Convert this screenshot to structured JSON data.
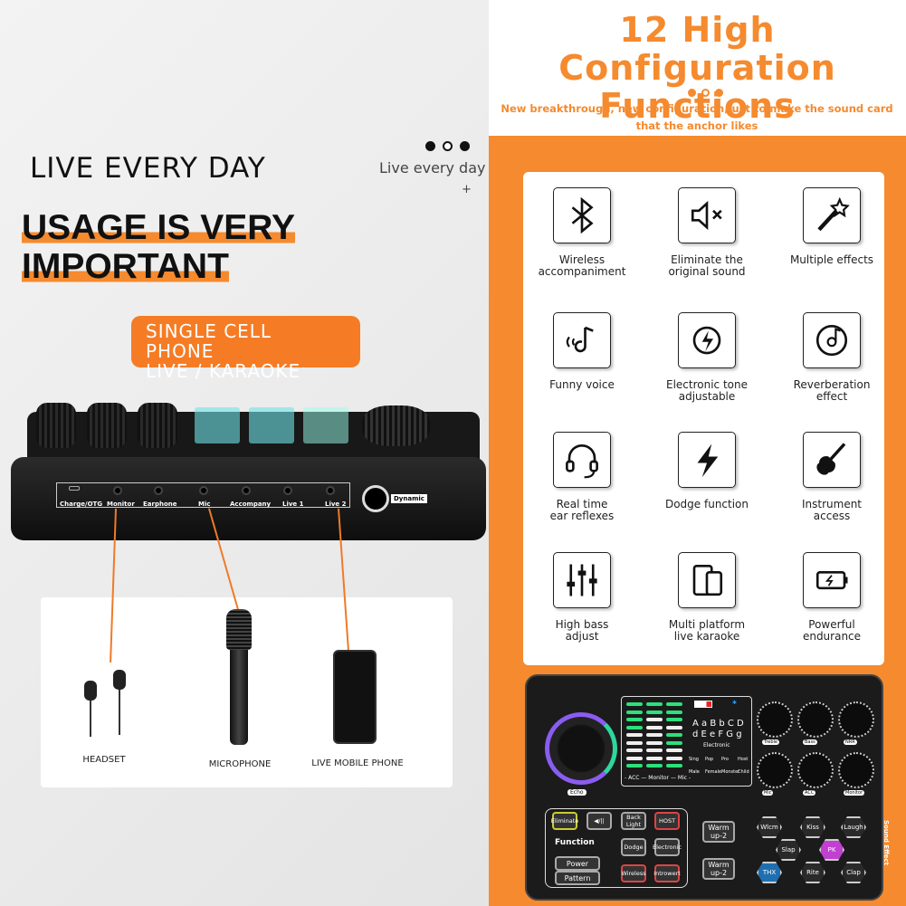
{
  "left": {
    "title": "LIVE EVERY DAY",
    "subtitle": "Live every day",
    "plus": "+",
    "headline": [
      "USAGE IS VERY",
      "IMPORTANT"
    ],
    "pill": [
      "SINGLE CELL PHONE",
      "LIVE / KARAOKE"
    ],
    "ports": [
      "Charge/OTG",
      "Monitor",
      "Earphone",
      "Mic",
      "Accompany",
      "Live 1",
      "Live 2"
    ],
    "dynamic": "Dynamic",
    "items": [
      "HEADSET",
      "MICROPHONE",
      "LIVE MOBILE PHONE"
    ],
    "accent": "#f58a2e"
  },
  "right": {
    "title": [
      "12 High Configuration",
      "Functions"
    ],
    "subtitle": [
      "New breakthrough, new configuration,just to make the sound card",
      "that the anchor likes"
    ],
    "features": [
      {
        "icon": "bluetooth-icon",
        "label": [
          "Wireless",
          "accompaniment"
        ]
      },
      {
        "icon": "mute-speaker-icon",
        "label": [
          "Eliminate the",
          "original sound"
        ]
      },
      {
        "icon": "magic-wand-icon",
        "label": [
          "Multiple effects",
          ""
        ]
      },
      {
        "icon": "music-note-voice-icon",
        "label": [
          "Funny voice",
          ""
        ]
      },
      {
        "icon": "electric-tone-icon",
        "label": [
          "Electronic tone",
          "adjustable"
        ]
      },
      {
        "icon": "music-disc-icon",
        "label": [
          "Reverberation",
          "effect"
        ]
      },
      {
        "icon": "headset-icon",
        "label": [
          "Real time",
          "ear reflexes"
        ]
      },
      {
        "icon": "lightning-icon",
        "label": [
          "Dodge function",
          ""
        ]
      },
      {
        "icon": "guitar-icon",
        "label": [
          "Instrument",
          "access"
        ]
      },
      {
        "icon": "equalizer-sliders-icon",
        "label": [
          "High bass",
          "adjust"
        ]
      },
      {
        "icon": "devices-icon",
        "label": [
          "Multi platform",
          "live karaoke"
        ]
      },
      {
        "icon": "battery-icon",
        "label": [
          "Powerful",
          "endurance"
        ]
      }
    ],
    "soundcard": {
      "echo": "Echo",
      "meter_label": "- ACC — Monitor — Mic -",
      "keys": [
        "A a B b C D",
        "d E e F G g"
      ],
      "electronic": "Electronic",
      "modes": [
        "Sing",
        "Pop",
        "Pro",
        "Host"
      ],
      "voices": [
        "Male",
        "Female",
        "Monster",
        "Child"
      ],
      "knobs": [
        "Treble",
        "Bass",
        "NRR",
        "Mic",
        "ACC",
        "Monitor"
      ],
      "buttons": [
        "Eliminate",
        "◀/||",
        "Back Light",
        "HOST",
        "Dodge",
        "Electronic",
        "Wireless",
        "Introwert"
      ],
      "function": "Function",
      "power": "Power",
      "pattern": "Pattern",
      "warm": [
        "Warm up-2",
        "Warm up-2"
      ],
      "effects": [
        "Wlcm",
        "Kiss",
        "Laugh",
        "Slap",
        "PK",
        "THX",
        "Rite",
        "Clap"
      ],
      "sound_effect": "Sound Effect"
    }
  }
}
